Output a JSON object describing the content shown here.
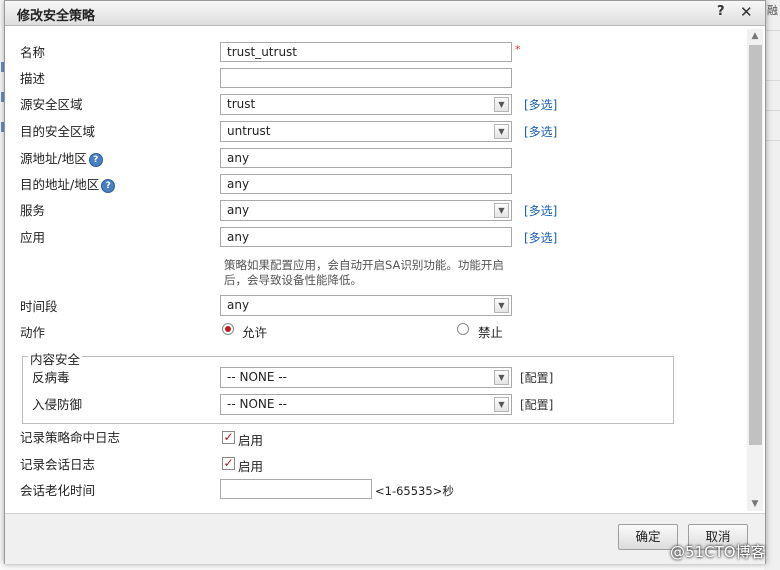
{
  "dialog": {
    "title": "修改安全策略",
    "help_glyph": "?",
    "close_glyph": "✕"
  },
  "background": {
    "right_text": "融"
  },
  "form": {
    "name": {
      "label": "名称",
      "value": "trust_utrust",
      "required_mark": "*"
    },
    "description": {
      "label": "描述",
      "value": ""
    },
    "source_zone": {
      "label": "源安全区域",
      "value": "trust",
      "multi_link": "[多选]"
    },
    "dest_zone": {
      "label": "目的安全区域",
      "value": "untrust",
      "multi_link": "[多选]"
    },
    "source_addr": {
      "label": "源地址/地区",
      "value": "any",
      "help": "?"
    },
    "dest_addr": {
      "label": "目的地址/地区",
      "value": "any",
      "help": "?"
    },
    "service": {
      "label": "服务",
      "value": "any",
      "multi_link": "[多选]"
    },
    "application": {
      "label": "应用",
      "value": "any",
      "multi_link": "[多选]",
      "note_line1": "策略如果配置应用，会自动开启SA识别功能。功能开启",
      "note_line2": "后，会导致设备性能降低。"
    },
    "time_range": {
      "label": "时间段",
      "value": "any"
    },
    "action": {
      "label": "动作",
      "permit": "允许",
      "deny": "禁止",
      "selected": "permit"
    },
    "content_security": {
      "legend": "内容安全",
      "antivirus": {
        "label": "反病毒",
        "value": "-- NONE --",
        "config_link": "[配置]"
      },
      "ips": {
        "label": "入侵防御",
        "value": "-- NONE --",
        "config_link": "[配置]"
      }
    },
    "log_policy_hit": {
      "label": "记录策略命中日志",
      "option": "启用",
      "checked": true
    },
    "log_session": {
      "label": "记录会话日志",
      "option": "启用",
      "checked": true
    },
    "session_aging": {
      "label": "会话老化时间",
      "value": "",
      "hint": "<1-65535>秒"
    }
  },
  "footer": {
    "ok_label": "确定",
    "cancel_label": "取消"
  },
  "watermark": "@51CTO博客",
  "colors": {
    "link": "#1a5fb4",
    "required": "#d33333",
    "radio_selected": "#c21a1a",
    "check_mark": "#b01818"
  }
}
